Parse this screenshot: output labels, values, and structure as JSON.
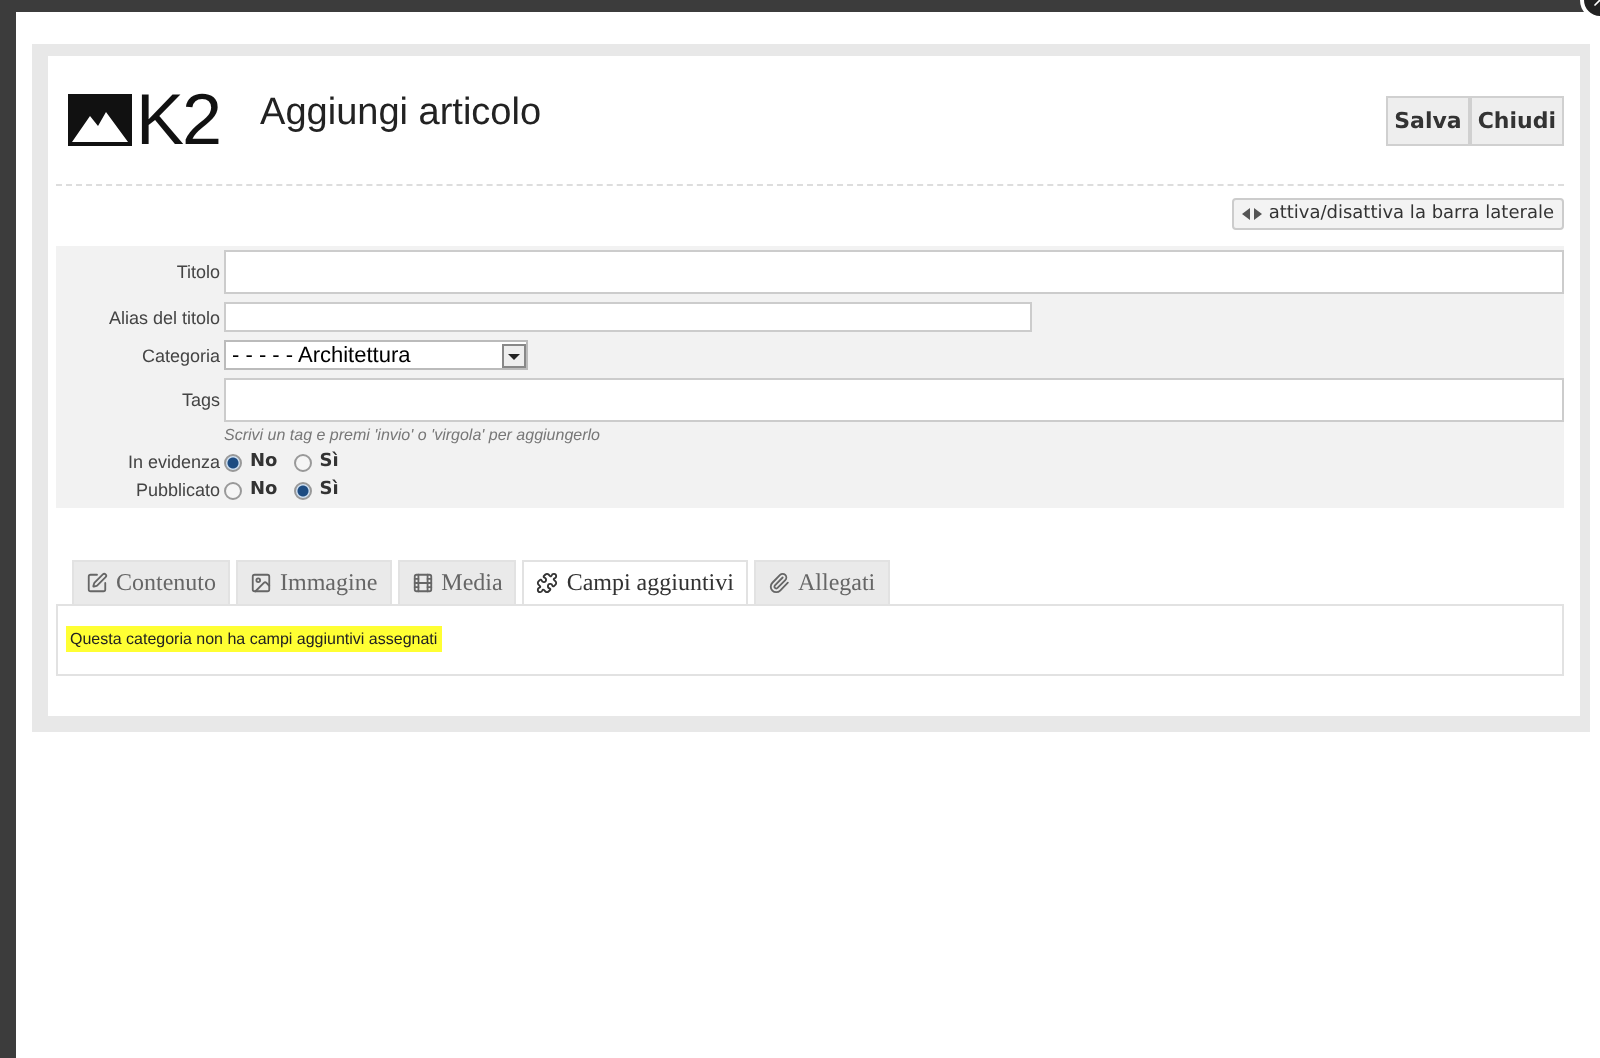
{
  "header": {
    "logo": "K2",
    "title": "Aggiungi articolo",
    "buttons": [
      "Salva",
      "Chiudi"
    ]
  },
  "sidebar_toggle": {
    "label": "attiva/disattiva la barra laterale"
  },
  "form": {
    "fields": [
      {
        "kind": "text",
        "label": "Titolo"
      },
      {
        "kind": "text",
        "label": "Alias del titolo"
      },
      {
        "kind": "select",
        "label": "Categoria",
        "value": "- - - - - Architettura"
      },
      {
        "kind": "text",
        "label": "Tags",
        "hint": "Scrivi un tag e premi 'invio' o 'virgola' per aggiungerlo"
      },
      {
        "kind": "radio",
        "label": "In evidenza",
        "options": [
          {
            "label": "No",
            "selected": true
          },
          {
            "label": "Sì",
            "selected": false
          }
        ]
      },
      {
        "kind": "radio",
        "label": "Pubblicato",
        "options": [
          {
            "label": "No",
            "selected": false
          },
          {
            "label": "Sì",
            "selected": true
          }
        ]
      }
    ]
  },
  "tabs": [
    {
      "label": "Contenuto",
      "selected": false
    },
    {
      "label": "Immagine",
      "selected": false
    },
    {
      "label": "Media",
      "selected": false
    },
    {
      "label": "Campi aggiuntivi",
      "selected": true
    },
    {
      "label": "Allegati",
      "selected": false
    }
  ],
  "tab_content": {
    "message": "Questa categoria non ha campi aggiuntivi assegnati"
  }
}
